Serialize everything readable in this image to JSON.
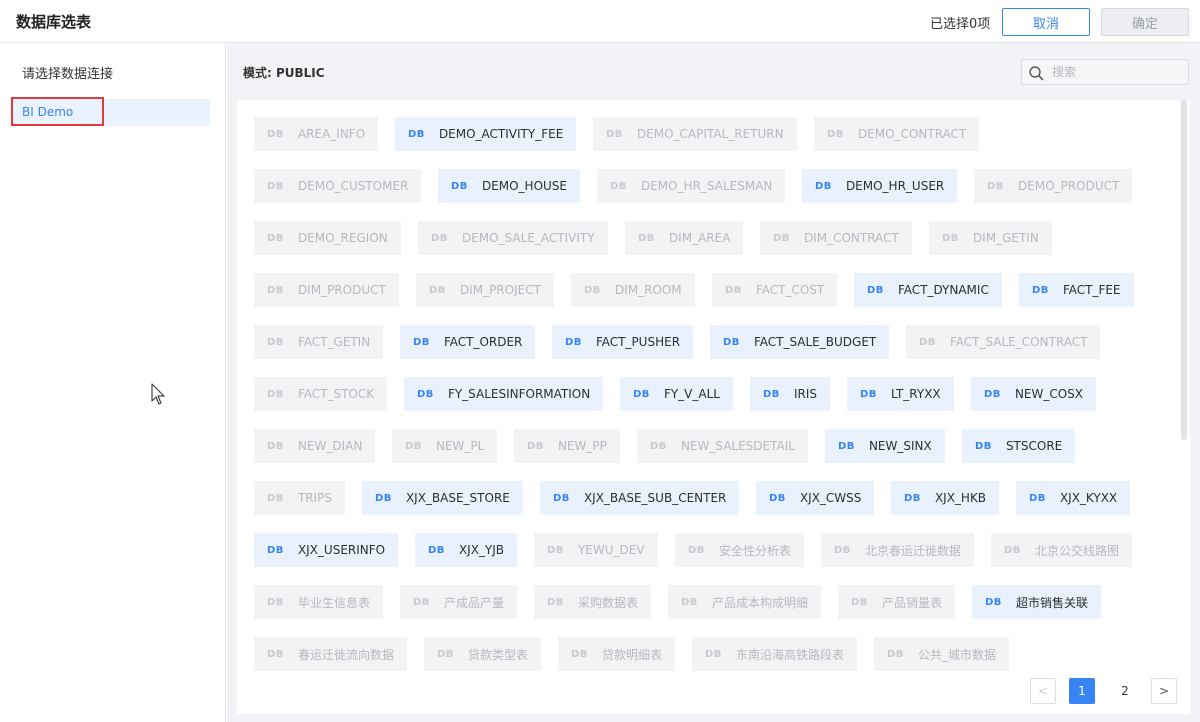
{
  "header": {
    "title": "数据库选表",
    "selected_count": "已选择0项",
    "cancel_label": "取消",
    "ok_label": "确定"
  },
  "sidebar": {
    "title": "请选择数据连接",
    "connections": [
      {
        "label": "BI Demo",
        "selected": true
      }
    ]
  },
  "main": {
    "schema_label": "模式: PUBLIC",
    "search": {
      "placeholder": "搜索",
      "value": ""
    },
    "db_icon_text": "DB",
    "rows": [
      [
        {
          "name": "AREA_INFO",
          "enabled": false
        },
        {
          "name": "DEMO_ACTIVITY_FEE",
          "enabled": true
        },
        {
          "name": "DEMO_CAPITAL_RETURN",
          "enabled": false
        },
        {
          "name": "DEMO_CONTRACT",
          "enabled": false
        }
      ],
      [
        {
          "name": "DEMO_CUSTOMER",
          "enabled": false
        },
        {
          "name": "DEMO_HOUSE",
          "enabled": true
        },
        {
          "name": "DEMO_HR_SALESMAN",
          "enabled": false
        },
        {
          "name": "DEMO_HR_USER",
          "enabled": true
        },
        {
          "name": "DEMO_PRODUCT",
          "enabled": false
        }
      ],
      [
        {
          "name": "DEMO_REGION",
          "enabled": false
        },
        {
          "name": "DEMO_SALE_ACTIVITY",
          "enabled": false
        },
        {
          "name": "DIM_AREA",
          "enabled": false
        },
        {
          "name": "DIM_CONTRACT",
          "enabled": false
        },
        {
          "name": "DIM_GETIN",
          "enabled": false
        }
      ],
      [
        {
          "name": "DIM_PRODUCT",
          "enabled": false
        },
        {
          "name": "DIM_PROJECT",
          "enabled": false
        },
        {
          "name": "DIM_ROOM",
          "enabled": false
        },
        {
          "name": "FACT_COST",
          "enabled": false
        },
        {
          "name": "FACT_DYNAMIC",
          "enabled": true
        },
        {
          "name": "FACT_FEE",
          "enabled": true
        }
      ],
      [
        {
          "name": "FACT_GETIN",
          "enabled": false
        },
        {
          "name": "FACT_ORDER",
          "enabled": true
        },
        {
          "name": "FACT_PUSHER",
          "enabled": true
        },
        {
          "name": "FACT_SALE_BUDGET",
          "enabled": true
        },
        {
          "name": "FACT_SALE_CONTRACT",
          "enabled": false
        }
      ],
      [
        {
          "name": "FACT_STOCK",
          "enabled": false
        },
        {
          "name": "FY_SALESINFORMATION",
          "enabled": true
        },
        {
          "name": "FY_V_ALL",
          "enabled": true
        },
        {
          "name": "IRIS",
          "enabled": true
        },
        {
          "name": "LT_RYXX",
          "enabled": true
        },
        {
          "name": "NEW_COSX",
          "enabled": true
        }
      ],
      [
        {
          "name": "NEW_DIAN",
          "enabled": false
        },
        {
          "name": "NEW_PL",
          "enabled": false
        },
        {
          "name": "NEW_PP",
          "enabled": false
        },
        {
          "name": "NEW_SALESDETAIL",
          "enabled": false
        },
        {
          "name": "NEW_SINX",
          "enabled": true
        },
        {
          "name": "STSCORE",
          "enabled": true
        }
      ],
      [
        {
          "name": "TRIPS",
          "enabled": false
        },
        {
          "name": "XJX_BASE_STORE",
          "enabled": true
        },
        {
          "name": "XJX_BASE_SUB_CENTER",
          "enabled": true
        },
        {
          "name": "XJX_CWSS",
          "enabled": true
        },
        {
          "name": "XJX_HKB",
          "enabled": true
        },
        {
          "name": "XJX_KYXX",
          "enabled": true
        }
      ],
      [
        {
          "name": "XJX_USERINFO",
          "enabled": true
        },
        {
          "name": "XJX_YJB",
          "enabled": true
        },
        {
          "name": "YEWU_DEV",
          "enabled": false
        },
        {
          "name": "安全性分析表",
          "enabled": false
        },
        {
          "name": "北京春运迁徙数据",
          "enabled": false
        },
        {
          "name": "北京公交线路图",
          "enabled": false
        }
      ],
      [
        {
          "name": "毕业生信息表",
          "enabled": false
        },
        {
          "name": "产成品产量",
          "enabled": false
        },
        {
          "name": "采购数据表",
          "enabled": false
        },
        {
          "name": "产品成本构成明细",
          "enabled": false
        },
        {
          "name": "产品销量表",
          "enabled": false
        },
        {
          "name": "超市销售关联",
          "enabled": true
        }
      ],
      [
        {
          "name": "春运迁徙流向数据",
          "enabled": false
        },
        {
          "name": "贷款类型表",
          "enabled": false
        },
        {
          "name": "贷款明细表",
          "enabled": false
        },
        {
          "name": "东南沿海高铁路段表",
          "enabled": false
        },
        {
          "name": "公共_城市数据",
          "enabled": false
        }
      ]
    ],
    "pagination": {
      "prev": "<",
      "pages": [
        "1",
        "2"
      ],
      "current": "1",
      "next": ">"
    }
  },
  "colors": {
    "accent": "#3685f2",
    "enabled_tag_bg": "#e9f1fc",
    "disabled_tag_bg": "#f2f3f5",
    "highlight_border": "#e0393e"
  }
}
